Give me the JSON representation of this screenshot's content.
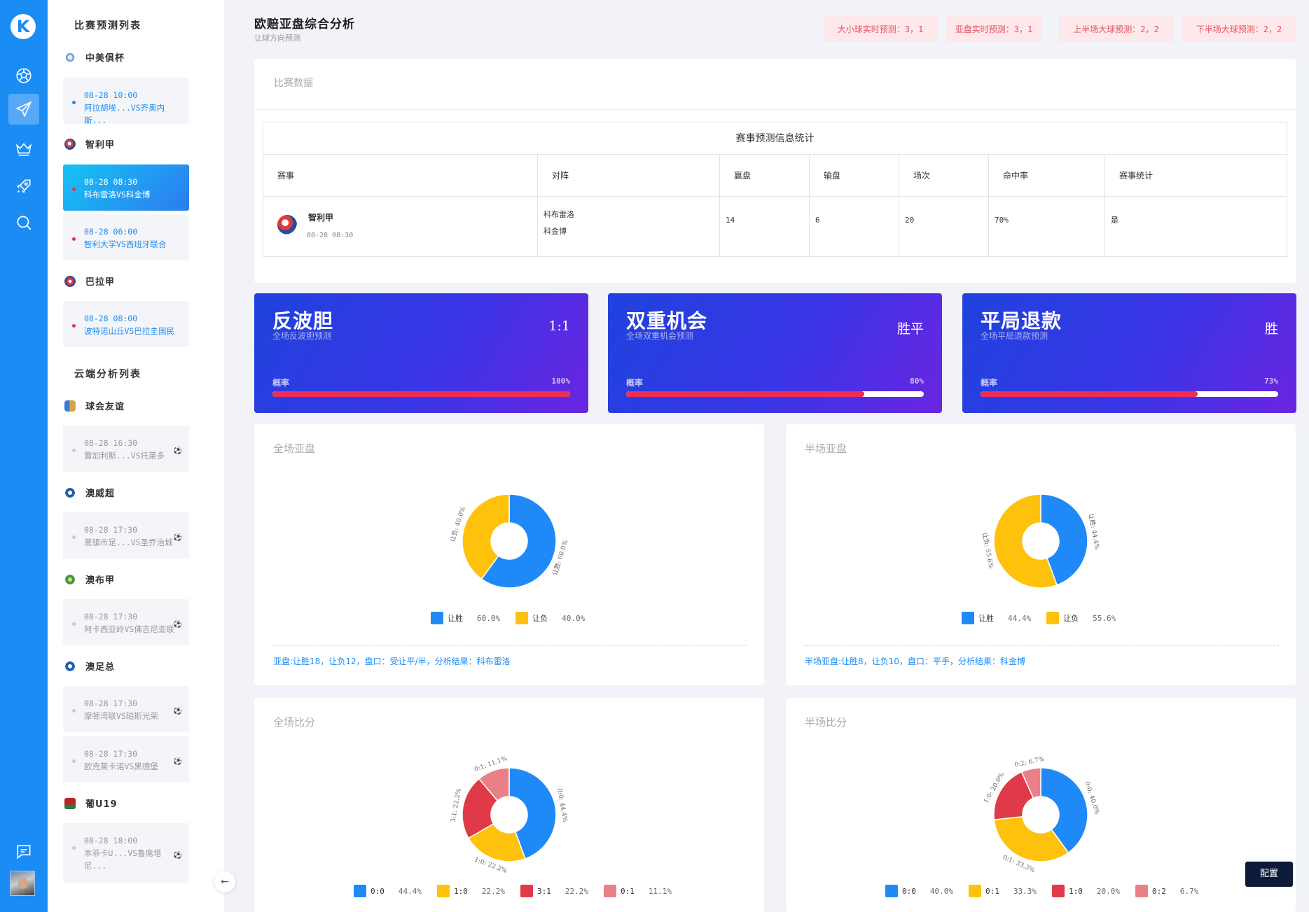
{
  "app": {
    "logo_letter": "K"
  },
  "header": {
    "title": "欧赔亚盘综合分析",
    "subtitle": "让球方向预测",
    "pills": [
      "大小球实时预测：3，1",
      "亚盘实时预测：3，1",
      "上半场大球预测：2，2",
      "下半场大球预测：2，2"
    ]
  },
  "sidebar": {
    "section1_title": "比赛预测列表",
    "section2_title": "云端分析列表",
    "leagues": [
      {
        "name": "中美俱杯",
        "matches": [
          {
            "time": "08-28 10:00",
            "teams": "阿拉胡埃...VS齐奥内斯..."
          }
        ]
      },
      {
        "name": "智利甲",
        "matches": [
          {
            "time": "08-28 08:30",
            "teams": "科布雷洛VS科金博"
          },
          {
            "time": "08-28 06:00",
            "teams": "智利大学VS西班牙联合"
          }
        ]
      },
      {
        "name": "巴拉甲",
        "matches": [
          {
            "time": "08-28 08:00",
            "teams": "波特诺山丘VS巴拉圭国民"
          }
        ]
      }
    ],
    "cloud_leagues": [
      {
        "name": "球会友谊",
        "matches": [
          {
            "time": "08-28 16:30",
            "teams": "雷加利斯...VS托莱多"
          }
        ]
      },
      {
        "name": "澳威超",
        "matches": [
          {
            "time": "08-28 17:30",
            "teams": "黑镇市足...VS圣乔治城"
          }
        ]
      },
      {
        "name": "澳布甲",
        "matches": [
          {
            "time": "08-28 17:30",
            "teams": "阿卡西亚岭VS佛吉尼亚联"
          }
        ]
      },
      {
        "name": "澳足总",
        "matches": [
          {
            "time": "08-28 17:30",
            "teams": "摩顿湾联VS珀斯光荣"
          },
          {
            "time": "08-28 17:30",
            "teams": "欧克莱卡诺VS黑德堡"
          }
        ]
      },
      {
        "name": "葡U19",
        "matches": [
          {
            "time": "08-28 18:00",
            "teams": "本菲卡U...VS鲁席塔",
            "teams2": "尼..."
          }
        ]
      }
    ],
    "ball_icon": "⚽",
    "collapse_icon": "arrow-left-icon"
  },
  "match_panel": {
    "title": "比赛数据",
    "table_caption": "赛事预测信息统计",
    "headers": [
      "赛事",
      "对阵",
      "赢盘",
      "输盘",
      "场次",
      "命中率",
      "赛事统计"
    ],
    "row": {
      "league": "智利甲",
      "time": "08-28 08:30",
      "home": "科布雷洛",
      "away": "科金博",
      "win": "14",
      "lose": "6",
      "games": "20",
      "hit": "70%",
      "stat": "是"
    }
  },
  "pred_cards": [
    {
      "title": "反波胆",
      "subtitle": "全场反波胆预测",
      "value": "1:1",
      "prob_label": "概率",
      "prob_text": "100%",
      "prob": 1.0
    },
    {
      "title": "双重机会",
      "subtitle": "全场双重机会预测",
      "value": "胜平",
      "prob_label": "概率",
      "prob_text": "80%",
      "prob": 0.8
    },
    {
      "title": "平局退款",
      "subtitle": "全场平局退款预测",
      "value": "胜",
      "prob_label": "概率",
      "prob_text": "73%",
      "prob": 0.73
    }
  ],
  "charts": [
    {
      "title": "全场亚盘",
      "summary": "亚盘:让胜18，让负12，盘口：受让平/半，分析结果：科布雷洛",
      "chart_data": {
        "type": "pie",
        "categories": [
          "让胜",
          "让负"
        ],
        "values": [
          60.0,
          40.0
        ],
        "colors": [
          "#1f8af7",
          "#fec20d"
        ],
        "labels": [
          "让胜: 60.0%",
          "让负: 40.0%"
        ],
        "legend_values": [
          "60.0%",
          "40.0%"
        ]
      }
    },
    {
      "title": "半场亚盘",
      "summary": "半场亚盘:让胜8，让负10，盘口：平手，分析结果：科金博",
      "chart_data": {
        "type": "pie",
        "categories": [
          "让胜",
          "让负"
        ],
        "values": [
          44.4,
          55.6
        ],
        "colors": [
          "#1f8af7",
          "#fec20d"
        ],
        "labels": [
          "让胜: 44.4%",
          "让负: 55.6%"
        ],
        "legend_values": [
          "44.4%",
          "55.6%"
        ]
      }
    },
    {
      "title": "全场比分",
      "summary": "",
      "chart_data": {
        "type": "pie",
        "categories": [
          "0:0",
          "1:0",
          "3:1",
          "0:1"
        ],
        "values": [
          44.4,
          22.2,
          22.2,
          11.1
        ],
        "colors": [
          "#1f8af7",
          "#fec20d",
          "#e03a48",
          "#e98088"
        ],
        "labels": [
          "0:0: 44.4%",
          "1:0: 22.2%",
          "3:1: 22.2%",
          "0:1: 11.1%"
        ],
        "legend_values": [
          "44.4%",
          "22.2%",
          "22.2%",
          "11.1%"
        ]
      }
    },
    {
      "title": "半场比分",
      "summary": "",
      "chart_data": {
        "type": "pie",
        "categories": [
          "0:0",
          "0:1",
          "1:0",
          "0:2"
        ],
        "values": [
          40.0,
          33.3,
          20.0,
          6.7
        ],
        "colors": [
          "#1f8af7",
          "#fec20d",
          "#e03a48",
          "#e98088"
        ],
        "labels": [
          "0:0: 40.0%",
          "0:1: 33.3%",
          "1:0: 20.0%",
          "0:2: 6.7%"
        ],
        "legend_values": [
          "40.0%",
          "33.3%",
          "20.0%",
          "6.7%"
        ]
      }
    }
  ],
  "config_button": "配置"
}
